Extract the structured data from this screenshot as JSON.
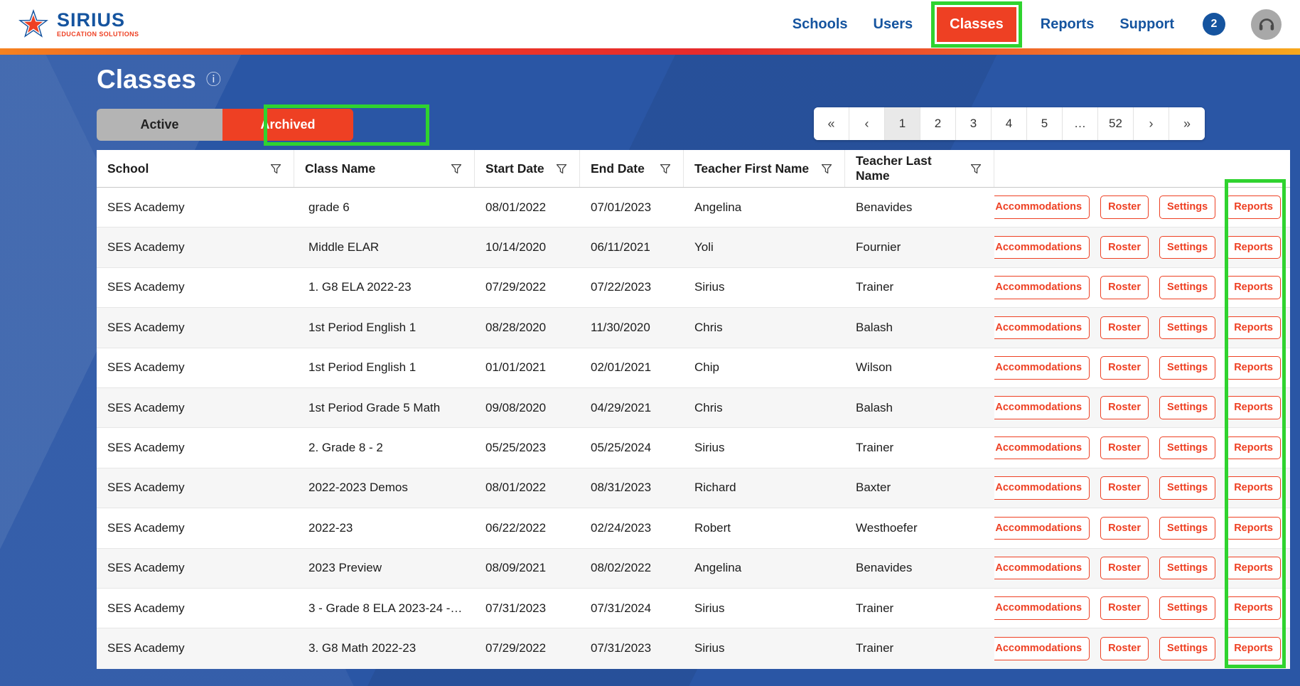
{
  "brand": {
    "name": "SIRIUS",
    "tagline": "EDUCATION SOLUTIONS"
  },
  "nav": {
    "items": [
      {
        "label": "Schools",
        "active": false
      },
      {
        "label": "Users",
        "active": false
      },
      {
        "label": "Classes",
        "active": true,
        "highlighted": true
      },
      {
        "label": "Reports",
        "active": false
      },
      {
        "label": "Support",
        "active": false
      }
    ],
    "notification_count": "2"
  },
  "page": {
    "title": "Classes",
    "info_icon": "ⓘ"
  },
  "tabs": [
    {
      "label": "Active",
      "selected": false
    },
    {
      "label": "Archived",
      "selected": true,
      "highlighted": true
    }
  ],
  "pagination": {
    "current": "1",
    "pages": [
      {
        "label": "«"
      },
      {
        "label": "‹"
      },
      {
        "label": "1",
        "current": true
      },
      {
        "label": "2"
      },
      {
        "label": "3"
      },
      {
        "label": "4"
      },
      {
        "label": "5"
      },
      {
        "label": "…"
      },
      {
        "label": "52"
      },
      {
        "label": "›"
      },
      {
        "label": "»"
      }
    ]
  },
  "table": {
    "columns": [
      "School",
      "Class Name",
      "Start Date",
      "End Date",
      "Teacher First Name",
      "Teacher Last Name"
    ],
    "row_actions": [
      "Accommodations",
      "Roster",
      "Settings",
      "Reports"
    ],
    "rows": [
      {
        "school": "SES Academy",
        "class_name": "grade 6",
        "start_date": "08/01/2022",
        "end_date": "07/01/2023",
        "teacher_first_name": "Angelina",
        "teacher_last_name": "Benavides"
      },
      {
        "school": "SES Academy",
        "class_name": "Middle ELAR",
        "start_date": "10/14/2020",
        "end_date": "06/11/2021",
        "teacher_first_name": "Yoli",
        "teacher_last_name": "Fournier"
      },
      {
        "school": "SES Academy",
        "class_name": "1. G8 ELA 2022-23",
        "start_date": "07/29/2022",
        "end_date": "07/22/2023",
        "teacher_first_name": "Sirius",
        "teacher_last_name": "Trainer"
      },
      {
        "school": "SES Academy",
        "class_name": "1st Period English 1",
        "start_date": "08/28/2020",
        "end_date": "11/30/2020",
        "teacher_first_name": "Chris",
        "teacher_last_name": "Balash"
      },
      {
        "school": "SES Academy",
        "class_name": "1st Period English 1",
        "start_date": "01/01/2021",
        "end_date": "02/01/2021",
        "teacher_first_name": "Chip",
        "teacher_last_name": "Wilson"
      },
      {
        "school": "SES Academy",
        "class_name": "1st Period Grade 5 Math",
        "start_date": "09/08/2020",
        "end_date": "04/29/2021",
        "teacher_first_name": "Chris",
        "teacher_last_name": "Balash"
      },
      {
        "school": "SES Academy",
        "class_name": "2. Grade 8 - 2",
        "start_date": "05/25/2023",
        "end_date": "05/25/2024",
        "teacher_first_name": "Sirius",
        "teacher_last_name": "Trainer"
      },
      {
        "school": "SES Academy",
        "class_name": "2022-2023 Demos",
        "start_date": "08/01/2022",
        "end_date": "08/31/2023",
        "teacher_first_name": "Richard",
        "teacher_last_name": "Baxter"
      },
      {
        "school": "SES Academy",
        "class_name": "2022-23",
        "start_date": "06/22/2022",
        "end_date": "02/24/2023",
        "teacher_first_name": "Robert",
        "teacher_last_name": "Westhoefer"
      },
      {
        "school": "SES Academy",
        "class_name": "2023 Preview",
        "start_date": "08/09/2021",
        "end_date": "08/02/2022",
        "teacher_first_name": "Angelina",
        "teacher_last_name": "Benavides"
      },
      {
        "school": "SES Academy",
        "class_name": "3 - Grade 8 ELA 2023-24 -…",
        "start_date": "07/31/2023",
        "end_date": "07/31/2024",
        "teacher_first_name": "Sirius",
        "teacher_last_name": "Trainer"
      },
      {
        "school": "SES Academy",
        "class_name": "3. G8 Math 2022-23",
        "start_date": "07/29/2022",
        "end_date": "07/31/2023",
        "teacher_first_name": "Sirius",
        "teacher_last_name": "Trainer"
      }
    ]
  },
  "colors": {
    "accent_orange": "#ee4023",
    "nav_blue": "#15549f",
    "highlight_green": "#2fd32f",
    "bg_blue": "#2a56a5"
  }
}
